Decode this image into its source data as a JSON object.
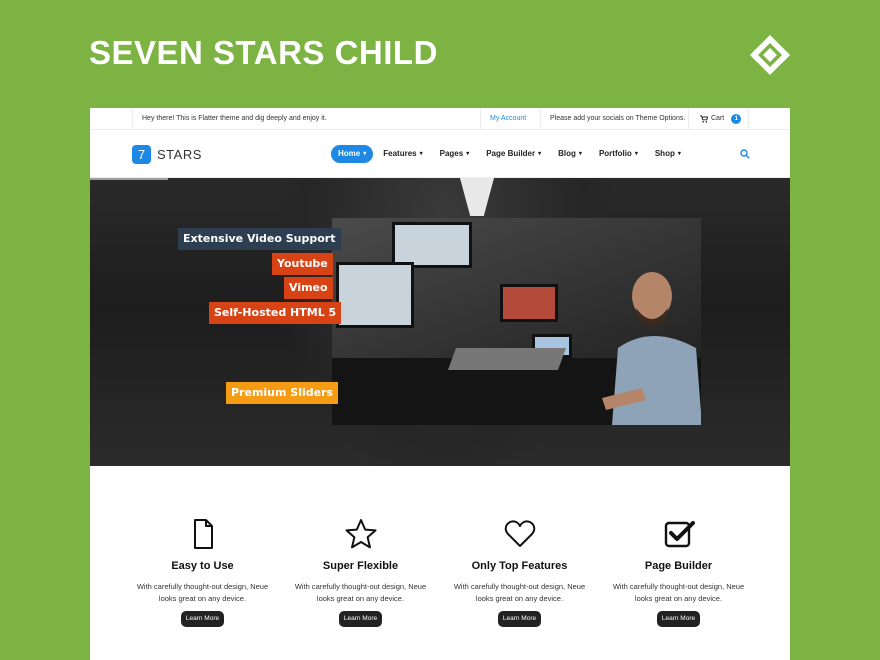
{
  "banner": {
    "title": "SEVEN STARS CHILD",
    "logo_icon": "diamond-logo-icon"
  },
  "topbar": {
    "welcome": "Hey there! This is Flatter theme and dig deeply and enjoy it.",
    "account": "My Account",
    "socials": "Please add your socials on Theme Options.",
    "cart_label": "Cart",
    "cart_count": "1"
  },
  "header": {
    "logo_number": "7",
    "logo_text": "STARS",
    "menu": [
      {
        "label": "Home",
        "active": true
      },
      {
        "label": "Features"
      },
      {
        "label": "Pages"
      },
      {
        "label": "Page Builder"
      },
      {
        "label": "Blog"
      },
      {
        "label": "Portfolio"
      },
      {
        "label": "Shop"
      }
    ],
    "caret": "▾"
  },
  "hero": {
    "tags": [
      {
        "text": "Extensive Video Support",
        "color": "#2c3e50"
      },
      {
        "text": "Youtube",
        "color": "#d84315"
      },
      {
        "text": "Vimeo",
        "color": "#d84315"
      },
      {
        "text": "Self-Hosted HTML 5",
        "color": "#d84315"
      },
      {
        "text": "Premium Sliders",
        "color": "#f59b14"
      }
    ]
  },
  "features": [
    {
      "icon": "document-icon",
      "title": "Easy to Use",
      "desc": "With carefully thought-out design, Neue looks great on any device.",
      "button": "Learn More"
    },
    {
      "icon": "star-icon",
      "title": "Super Flexible",
      "desc": "With carefully thought-out design, Neue looks great on any device.",
      "button": "Learn More"
    },
    {
      "icon": "heart-icon",
      "title": "Only Top Features",
      "desc": "With carefully thought-out design, Neue looks great on any device.",
      "button": "Learn More"
    },
    {
      "icon": "checkbox-icon",
      "title": "Page Builder",
      "desc": "With carefully thought-out design, Neue looks great on any device.",
      "button": "Learn More"
    }
  ],
  "colors": {
    "background": "#7cb342",
    "accent": "#1e88e5",
    "dark": "#222222"
  }
}
